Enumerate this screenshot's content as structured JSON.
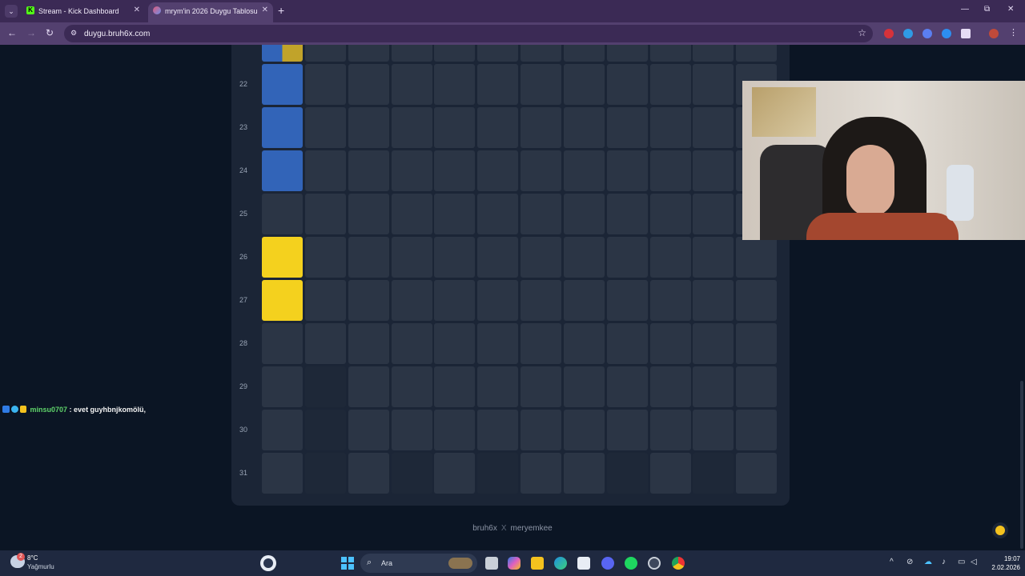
{
  "browser": {
    "tabs": [
      {
        "label": "Stream - Kick Dashboard",
        "favicon": "K"
      },
      {
        "label": "mrym'in 2026 Duygu Tablosu"
      }
    ],
    "url": "duygu.bruh6x.com",
    "colors": {
      "frame": "#3b2a55",
      "toolbar": "#53406f"
    }
  },
  "board": {
    "row_labels": [
      "22",
      "23",
      "24",
      "25",
      "26",
      "27",
      "28",
      "29",
      "30",
      "31"
    ],
    "colors": {
      "blue": "#3264b8",
      "yellow": "#f4d11e",
      "filled": "#2b3545",
      "empty": "#1e2838"
    },
    "cell_states": [
      [
        "split",
        "filled",
        "filled",
        "filled",
        "filled",
        "filled",
        "filled",
        "filled",
        "filled",
        "filled",
        "filled",
        "filled"
      ],
      [
        "blue",
        "filled",
        "filled",
        "filled",
        "filled",
        "filled",
        "filled",
        "filled",
        "filled",
        "filled",
        "filled",
        "filled"
      ],
      [
        "blue",
        "filled",
        "filled",
        "filled",
        "filled",
        "filled",
        "filled",
        "filled",
        "filled",
        "filled",
        "filled",
        "filled"
      ],
      [
        "blue",
        "filled",
        "filled",
        "filled",
        "filled",
        "filled",
        "filled",
        "filled",
        "filled",
        "filled",
        "filled",
        "filled"
      ],
      [
        "filled",
        "filled",
        "filled",
        "filled",
        "filled",
        "filled",
        "filled",
        "filled",
        "filled",
        "filled",
        "filled",
        "filled"
      ],
      [
        "yellow",
        "filled",
        "filled",
        "filled",
        "filled",
        "filled",
        "filled",
        "filled",
        "filled",
        "filled",
        "filled",
        "filled"
      ],
      [
        "yellow",
        "filled",
        "filled",
        "filled",
        "filled",
        "filled",
        "filled",
        "filled",
        "filled",
        "filled",
        "filled",
        "filled"
      ],
      [
        "filled",
        "filled",
        "filled",
        "filled",
        "filled",
        "filled",
        "filled",
        "filled",
        "filled",
        "filled",
        "filled",
        "filled"
      ],
      [
        "filled",
        "empty",
        "filled",
        "filled",
        "filled",
        "filled",
        "filled",
        "filled",
        "filled",
        "filled",
        "filled",
        "filled"
      ],
      [
        "filled",
        "empty",
        "filled",
        "filled",
        "filled",
        "filled",
        "filled",
        "filled",
        "filled",
        "filled",
        "filled",
        "filled"
      ],
      [
        "filled",
        "empty",
        "filled",
        "empty",
        "filled",
        "empty",
        "filled",
        "filled",
        "empty",
        "filled",
        "empty",
        "filled"
      ]
    ]
  },
  "footer": {
    "left": "bruh6x",
    "sep": "X",
    "right": "meryemkee"
  },
  "chat": {
    "user": "minsu0707",
    "sep": " : ",
    "message": "evet guyhbnjkomölü,"
  },
  "taskbar": {
    "temperature": "8°C",
    "condition": "Yağmurlu",
    "weather_badge": "2",
    "search_placeholder": "Ara",
    "time": "19:07",
    "date": "2.02.2026"
  }
}
